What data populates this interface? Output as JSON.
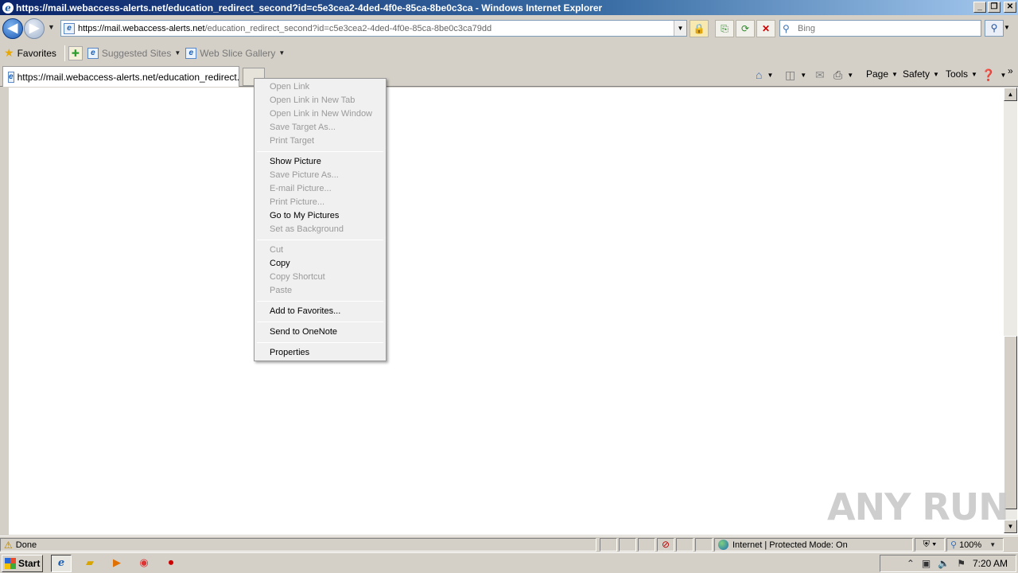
{
  "window": {
    "title": "https://mail.webaccess-alerts.net/education_redirect_second?id=c5e3cea2-4ded-4f0e-85ca-8be0c3ca - Windows Internet Explorer",
    "controls": {
      "minimize": "_",
      "restore": "❐",
      "close": "✕"
    }
  },
  "address_bar": {
    "url_host": "https://mail.webaccess-alerts.net",
    "url_rest": "/education_redirect_second?id=c5e3cea2-4ded-4f0e-85ca-8be0c3ca79dd"
  },
  "search": {
    "placeholder": "Bing"
  },
  "favorites_bar": {
    "favorites_label": "Favorites",
    "items": [
      {
        "label": "Suggested Sites"
      },
      {
        "label": "Web Slice Gallery"
      }
    ]
  },
  "tab": {
    "title": "https://mail.webaccess-alerts.net/education_redirect..."
  },
  "command_bar": {
    "page": "Page",
    "safety": "Safety",
    "tools": "Tools"
  },
  "context_menu": {
    "groups": [
      [
        {
          "label": "Open Link",
          "enabled": false
        },
        {
          "label": "Open Link in New Tab",
          "enabled": false
        },
        {
          "label": "Open Link in New Window",
          "enabled": false
        },
        {
          "label": "Save Target As...",
          "enabled": false
        },
        {
          "label": "Print Target",
          "enabled": false
        }
      ],
      [
        {
          "label": "Show Picture",
          "enabled": true
        },
        {
          "label": "Save Picture As...",
          "enabled": false
        },
        {
          "label": "E-mail Picture...",
          "enabled": false
        },
        {
          "label": "Print Picture...",
          "enabled": false
        },
        {
          "label": "Go to My Pictures",
          "enabled": true
        },
        {
          "label": "Set as Background",
          "enabled": false
        }
      ],
      [
        {
          "label": "Cut",
          "enabled": false
        },
        {
          "label": "Copy",
          "enabled": true
        },
        {
          "label": "Copy Shortcut",
          "enabled": false
        },
        {
          "label": "Paste",
          "enabled": false
        }
      ],
      [
        {
          "label": "Add to Favorites...",
          "enabled": true
        }
      ],
      [
        {
          "label": "Send to OneNote",
          "enabled": true
        }
      ],
      [
        {
          "label": "Properties",
          "enabled": true
        }
      ]
    ]
  },
  "status_bar": {
    "status": "Done",
    "zone": "Internet | Protected Mode: On",
    "zoom": "100%"
  },
  "taskbar": {
    "start_label": "Start",
    "clock": "7:20 AM"
  },
  "watermark": "ANY RUN",
  "colors": {
    "title_gradient_start": "#0a246a",
    "chrome_bg": "#d4d0c8",
    "menu_bg": "#f0f0f0",
    "disabled_text": "#9a9a9a"
  }
}
